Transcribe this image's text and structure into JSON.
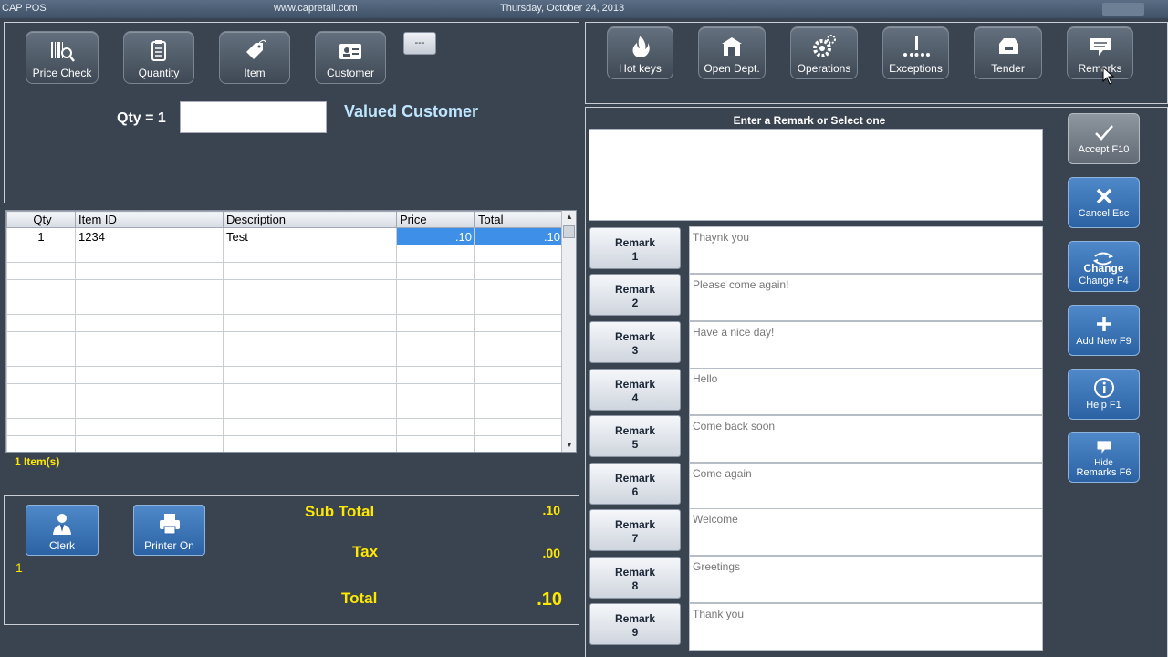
{
  "window": {
    "app_name": "CAP POS",
    "website": "www.capretail.com",
    "date": "Thursday, October 24, 2013"
  },
  "top_toolbar": {
    "price_check": "Price Check",
    "quantity": "Quantity",
    "item": "Item",
    "customer": "Customer",
    "ellipsis": "---"
  },
  "entry": {
    "qty_label": "Qty = 1",
    "input_value": "",
    "customer_type": "Valued Customer"
  },
  "grid": {
    "columns": [
      "Qty",
      "Item ID",
      "Description",
      "Price",
      "Total"
    ],
    "rows": [
      [
        "1",
        "1234",
        "Test",
        ".10",
        ".10"
      ]
    ]
  },
  "items_count": "1 Item(s)",
  "bottom": {
    "clerk": "Clerk",
    "printer": "Printer On",
    "clerk_id": "1",
    "sub_total_label": "Sub Total",
    "sub_total_value": ".10",
    "tax_label": "Tax",
    "tax_value": ".00",
    "total_label": "Total",
    "total_value": ".10"
  },
  "right_toolbar": {
    "hot_keys": "Hot keys",
    "open_dept": "Open Dept.",
    "operations": "Operations",
    "exceptions": "Exceptions",
    "tender": "Tender",
    "remarks": "Remarks"
  },
  "remarks": {
    "title": "Enter a Remark or Select one",
    "entry_value": "",
    "items": [
      {
        "label": "Remark",
        "num": "1",
        "text": "Thaynk you"
      },
      {
        "label": "Remark",
        "num": "2",
        "text": "Please come again!"
      },
      {
        "label": "Remark",
        "num": "3",
        "text": "Have a nice day!"
      },
      {
        "label": "Remark",
        "num": "4",
        "text": "Hello"
      },
      {
        "label": "Remark",
        "num": "5",
        "text": "Come back soon"
      },
      {
        "label": "Remark",
        "num": "6",
        "text": "Come again"
      },
      {
        "label": "Remark",
        "num": "7",
        "text": "Welcome"
      },
      {
        "label": "Remark",
        "num": "8",
        "text": "Greetings"
      },
      {
        "label": "Remark",
        "num": "9",
        "text": "Thank you"
      }
    ]
  },
  "actions": {
    "accept": "Accept F10",
    "cancel": "Cancel Esc",
    "change_line1": "Change",
    "change_line2": "Change F4",
    "add_new": "Add New F9",
    "help": "Help F1",
    "hide_line1": "Hide",
    "hide_line2": "Remarks F6"
  },
  "colors": {
    "background": "#3a4350",
    "accent_yellow": "#ffe800",
    "action_blue": "#2b62a3",
    "selection_blue": "#3d8fe8"
  }
}
